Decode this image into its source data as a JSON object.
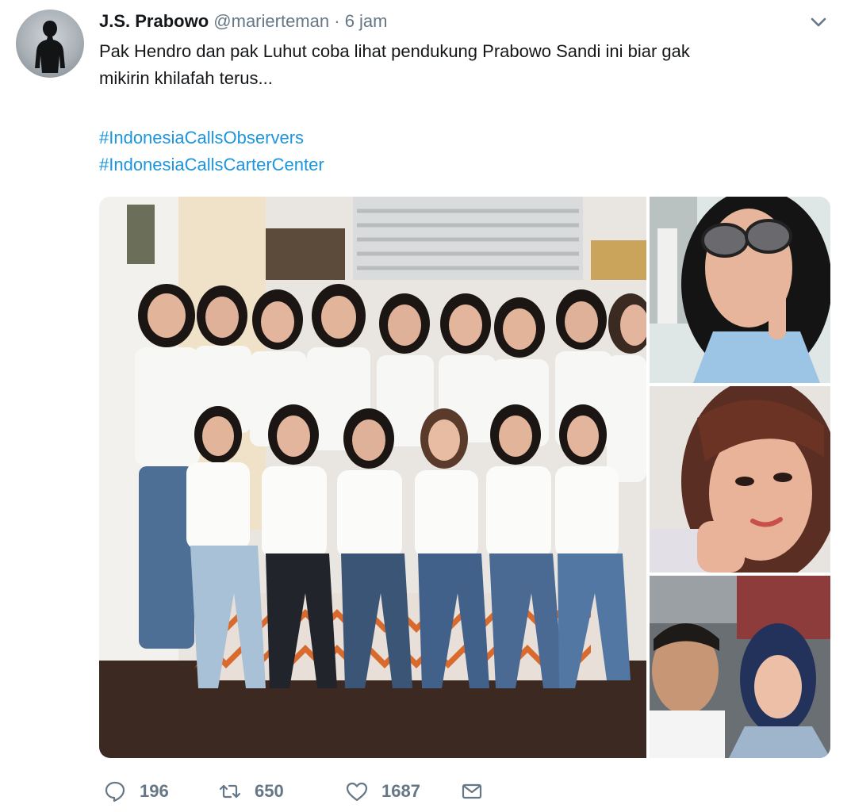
{
  "tweet": {
    "author_name": "J.S. Prabowo",
    "author_handle": "@marierteman",
    "separator": "·",
    "timestamp": "6 jam",
    "text_lines": [
      "Pak Hendro dan pak Luhut coba lihat pendukung Prabowo Sandi ini biar gak",
      "mikirin khilafah terus..."
    ],
    "hashtags": [
      "#IndonesiaCallsObservers",
      "#IndonesiaCallsCarterCenter"
    ]
  },
  "actions": {
    "reply_count": "196",
    "retweet_count": "650",
    "like_count": "1687"
  },
  "icons": {
    "menu": "chevron-down-icon",
    "reply": "speech-bubble-icon",
    "retweet": "retweet-arrows-icon",
    "like": "heart-icon",
    "message": "envelope-icon"
  },
  "colors": {
    "link": "#1b95e0",
    "secondary_text": "#657786",
    "primary_text": "#14171a"
  }
}
